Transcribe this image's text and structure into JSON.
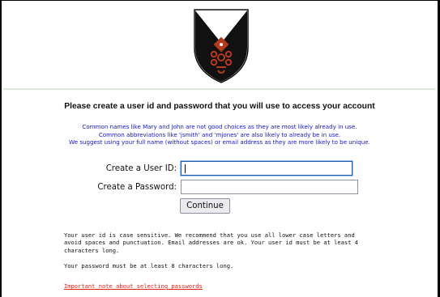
{
  "branding": {
    "crest_icon": "shield-crest-icon",
    "colors": {
      "shield_black": "#111111",
      "emblem_red": "#b5391c"
    }
  },
  "form": {
    "heading": "Please create a user id and password that you will use to access your account",
    "advice_lines": [
      "Common names like Mary and John are not good choices as they are most likely already in use.",
      "Common abbreviations like 'jsmith' and 'mjones' are also likely to already be in use.",
      "We suggest using your full name (without spaces) or email address as they are more likely to be unique."
    ],
    "user_id_label": "Create a User ID:",
    "user_id_value": "",
    "password_label": "Create a Password:",
    "password_value": "",
    "continue_label": "Continue"
  },
  "notes": {
    "user_id_note": "Your user id is case sensitive. We recommend that you use all lower case letters and avoid spaces and punctuation. Email addresses are ok. Your user id must be at least 4 characters long.",
    "password_note": "Your password must be at least 8 characters long.",
    "password_link": "Important note about selecting passwords"
  },
  "colors": {
    "advice_text": "#1515c8",
    "link_text": "#e0201a",
    "divider": "#d9ead6"
  }
}
